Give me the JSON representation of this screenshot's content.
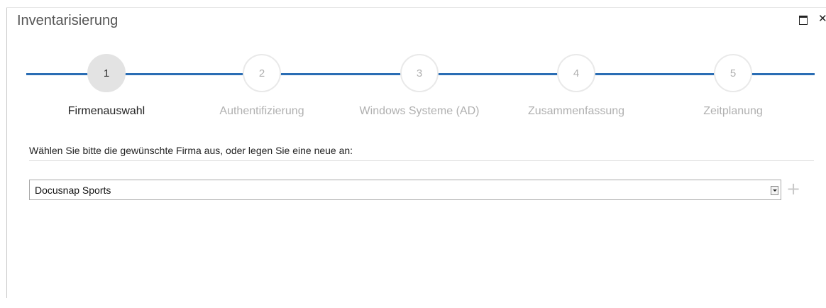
{
  "window": {
    "title": "Inventarisierung",
    "maximize_icon": "maximize-icon",
    "close_icon": "close-icon",
    "close_glyph": "✕"
  },
  "wizard": {
    "accent_color": "#2a6db4",
    "current_step": 1,
    "steps": [
      {
        "number": "1",
        "label": "Firmenauswahl",
        "active": true
      },
      {
        "number": "2",
        "label": "Authentifizierung",
        "active": false
      },
      {
        "number": "3",
        "label": "Windows Systeme (AD)",
        "active": false
      },
      {
        "number": "4",
        "label": "Zusammenfassung",
        "active": false
      },
      {
        "number": "5",
        "label": "Zeitplanung",
        "active": false
      }
    ]
  },
  "content": {
    "instruction": "Wählen Sie bitte die gewünschte Firma aus, oder legen Sie eine neue an:",
    "company_select": {
      "value": "Docusnap Sports"
    },
    "add_button_glyph": "+",
    "add_icon": "plus-icon"
  }
}
